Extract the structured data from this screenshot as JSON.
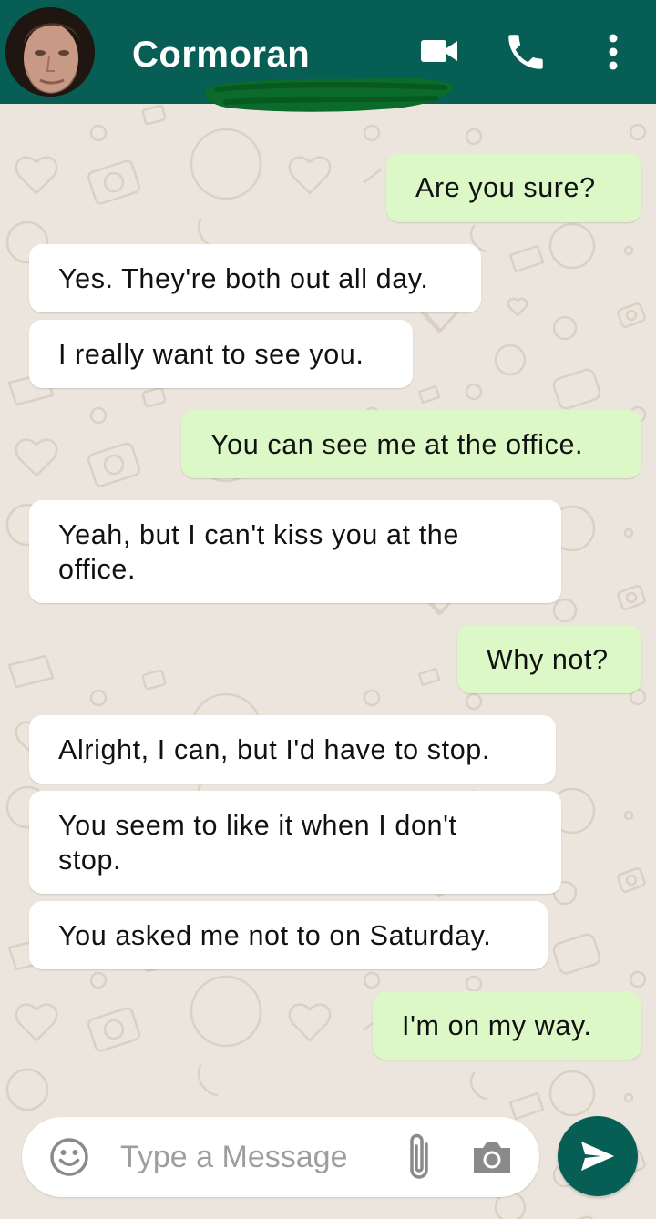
{
  "header": {
    "contact_name": "Cormoran",
    "icons": [
      "avatar",
      "video-call-icon",
      "phone-icon",
      "more-vert-icon"
    ],
    "bar_color": "#075e54"
  },
  "messages": [
    {
      "direction": "outgoing",
      "text": [
        "Are you sure?"
      ]
    },
    {
      "direction": "incoming",
      "text": [
        "Yes. They're both out all day."
      ]
    },
    {
      "direction": "incoming",
      "text": [
        "I really want to see you."
      ]
    },
    {
      "direction": "outgoing",
      "text": [
        "You can see me at the office."
      ]
    },
    {
      "direction": "incoming",
      "text": [
        "Yeah, but I can't kiss you at the",
        "office."
      ]
    },
    {
      "direction": "outgoing",
      "text": [
        "Why not?"
      ]
    },
    {
      "direction": "incoming",
      "text": [
        "Alright, I can, but I'd have to stop."
      ]
    },
    {
      "direction": "incoming",
      "text": [
        "You seem to like it when I don't",
        "stop."
      ]
    },
    {
      "direction": "incoming",
      "text": [
        "You asked me not to on Saturday."
      ]
    },
    {
      "direction": "outgoing",
      "text": [
        "I'm on my way."
      ]
    }
  ],
  "composer": {
    "placeholder": "Type a Message",
    "value": "",
    "icons": [
      "emoji-icon",
      "paperclip-icon",
      "camera-icon",
      "send-icon"
    ]
  },
  "colors": {
    "incoming_bubble": "#ffffff",
    "outgoing_bubble": "#dcf8c6",
    "chat_background": "#ece5dd",
    "accent": "#075e54"
  }
}
